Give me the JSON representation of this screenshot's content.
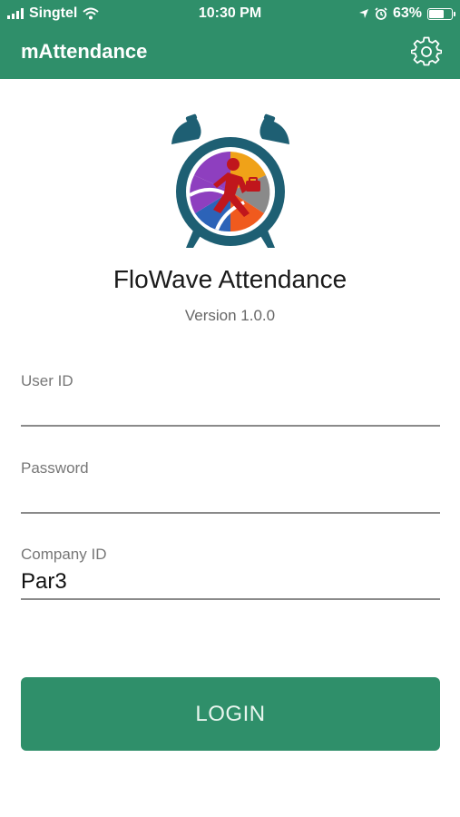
{
  "status_bar": {
    "carrier": "Singtel",
    "time": "10:30 PM",
    "battery_percent": "63%"
  },
  "header": {
    "title": "mAttendance",
    "settings_icon": "gear-icon"
  },
  "brand": {
    "name": "FloWave Attendance",
    "version": "Version 1.0.0"
  },
  "form": {
    "user_id": {
      "label": "User ID",
      "value": ""
    },
    "password": {
      "label": "Password",
      "value": ""
    },
    "company_id": {
      "label": "Company ID",
      "value": "Par3"
    }
  },
  "login_label": "LOGIN",
  "colors": {
    "primary": "#2f8f6a",
    "logo_teal": "#1e5f73"
  }
}
